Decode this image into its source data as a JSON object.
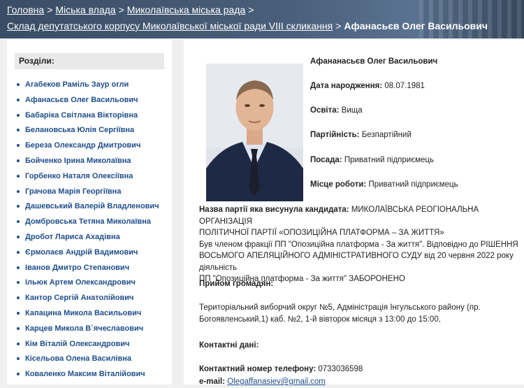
{
  "breadcrumb": {
    "items": [
      "Головна",
      "Міська влада",
      "Миколаївська міська рада",
      "Склад депутатського корпусу Миколаївської міської ради VIII скликання"
    ],
    "current": "Афанасьєв Олег Васильович",
    "separator": ">"
  },
  "sidebar": {
    "title": "Розділи:",
    "items": [
      "Агабеков Раміль Заур огли",
      "Афанасьєв Олег Васильович",
      "Бабаріка Світлана Вікторівна",
      "Белановська Юлія Сергіївна",
      "Береза Олександр Дмитрович",
      "Бойченко Ірина Миколаївна",
      "Горбенко Наталя Олексіївна",
      "Грачова Марія Георгіївна",
      "Дашевський Валерій Владленович",
      "Домбровська Тетяна Миколаївна",
      "Дробот Лариса Ахадівна",
      "Єрмолаєв Андрій Вадимович",
      "Іванов Дмитро Степанович",
      "Ільюк Артем Олександрович",
      "Кантор Сергій Анатолійович",
      "Капацина Микола Васильович",
      "Карцев Микола В`ячеславович",
      "Кім Віталій Олександрович",
      "Кісельова Олена Василівна",
      "Коваленко Максим Віталійович"
    ]
  },
  "profile": {
    "name": "Афананасьєв Олег Васильович",
    "birth_label": "Дата народження:",
    "birth_value": "08.07.1981",
    "education_label": "Освіта:",
    "education_value": "Вища",
    "party_label": "Партійність:",
    "party_value": "Безпартійний",
    "position_label": "Посада:",
    "position_value": "Приватний підприємець",
    "work_label": "Місце роботи:",
    "work_value": "Приватний підприємець",
    "nominating_label": "Назва партії яка висунула кандидата:",
    "nominating_value_1": " МИКОЛАЇВСЬКА РЕОГІОНАЛЬНА ОРГАНІЗАЦІЯ",
    "nominating_value_2": "ПОЛІТИЧНОЇ ПАРТІЇ «ОПОЗИЦІЙНА ПЛАТФОРМА – ЗА ЖИТТЯ»",
    "note_1": "Був членом фракції ПП \"Опозиційна платформа - За життя\". Відповідно до РІШЕННЯ",
    "note_2": "ВОСЬМОГО АПЕЛЯЦІЙНОГО АДМІНІСТРАТИВНОГО СУДУ від 20 червня 2022 року діяльність",
    "note_3": "ПП \"Опозиційна платформа - За життя\" ЗАБОРОНЕНО",
    "reception_label": "Прийом громадян:",
    "reception_text_1": "Територіальний виборчий округ №5, Адміністрація Інгульського району (пр.",
    "reception_text_2": "Богоявленський,1) каб. №2, 1-й вівторок місяця з 13:00 до 15:00,",
    "contacts_label": "Контактні дані:",
    "phone_label": "Контактний номер телефону:",
    "phone_value": "0733036598",
    "email_label": "e-mail:",
    "email_value": "Olegaffanasiev@gmail.com"
  }
}
